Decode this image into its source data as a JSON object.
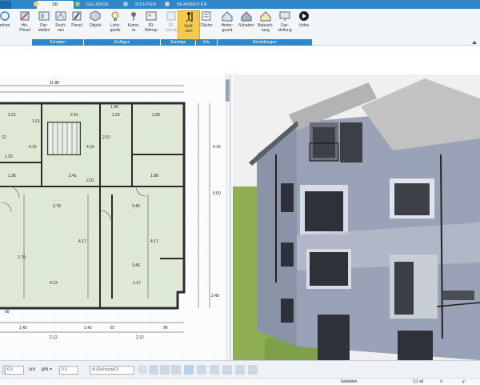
{
  "tabs": [
    {
      "label": "3D",
      "active": true
    },
    {
      "label": "GELÄNDE",
      "active": false
    },
    {
      "label": "SICHTEN",
      "active": false
    },
    {
      "label": "BEARBEITEN",
      "active": false
    }
  ],
  "ribbon": {
    "buttons": [
      {
        "label": "rehen",
        "icon": "rotate-icon"
      },
      {
        "label": "Hin.\nPinsel",
        "icon": "brush-icon"
      },
      {
        "label": "Dar-\nstellen",
        "icon": "display-icon"
      },
      {
        "label": "Rech-\nnen",
        "icon": "compute-icon"
      },
      {
        "label": "Pinsel",
        "icon": "paintbrush-icon"
      },
      {
        "label": "Objekt",
        "icon": "object-icon"
      },
      {
        "label": "Licht-\nquelle",
        "icon": "lightbulb-icon"
      },
      {
        "label": "Kame-\nra",
        "icon": "camera-icon"
      },
      {
        "label": "3D-\nBitmap",
        "icon": "bitmap-icon"
      },
      {
        "label": "3D-\nSchnitt",
        "icon": "section-icon",
        "disabled": true
      },
      {
        "label": "Kolli-\nsion",
        "icon": "collision-icon",
        "active": true
      },
      {
        "label": "Fläche",
        "icon": "area-icon"
      },
      {
        "label": "Hinter-\ngrund",
        "icon": "background-icon"
      },
      {
        "label": "Schatten",
        "icon": "shadow-icon"
      },
      {
        "label": "Beleuch-\ntung",
        "icon": "lighting-icon"
      },
      {
        "label": "Dar-\nstellung",
        "icon": "rendering-icon"
      },
      {
        "label": "Video",
        "icon": "video-icon"
      }
    ],
    "groups": [
      "Schatten",
      "Einfügen",
      "Sonstige",
      "Info",
      "Einstellungen"
    ]
  },
  "plan": {
    "dimensions": [
      "11.80",
      "3.21",
      "2.41",
      "1.62",
      "1.68",
      "3.79",
      "3.45",
      "3.45",
      "4.12",
      "4.17",
      "4.17",
      "2.79",
      "2.41",
      "2.01",
      "1.68",
      "1.36",
      "4.16",
      "4.16",
      "4.16",
      "9.00",
      "1.42",
      "1.42",
      "2.12",
      "2.12",
      "87",
      "96",
      "1.20",
      "2.51",
      "2.48",
      "1.01",
      "1.40",
      "12",
      "1.17",
      "60"
    ]
  },
  "bottombar": {
    "zoom_value": "6.0",
    "unit": "cm",
    "phi_label": "phi =",
    "phi_value": "0.0",
    "direction": "dl (Richtung/Di"
  },
  "statusbar": {
    "mode": "Selektion",
    "scale": "1:1 wl",
    "x_label": "x:",
    "y_label": "y:"
  },
  "colors": {
    "accent": "#2f87c8",
    "active_button": "#f6c94c",
    "plan_fill": "#dde9d5",
    "wall": "#2a2a2a"
  }
}
